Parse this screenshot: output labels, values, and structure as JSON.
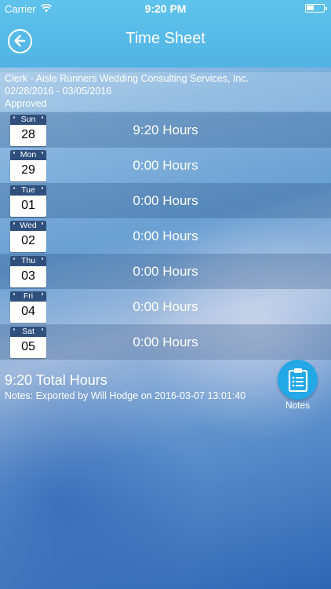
{
  "status_bar": {
    "carrier": "Carrier",
    "time": "9:20 PM"
  },
  "header": {
    "title": "Time Sheet"
  },
  "info": {
    "job": "Clerk - Aisle Runners Wedding Consulting Services, Inc.",
    "date_range": "02/28/2016 - 03/05/2016",
    "status": "Approved"
  },
  "days": [
    {
      "weekday": "Sun",
      "date": "28",
      "hours": "9:20 Hours"
    },
    {
      "weekday": "Mon",
      "date": "29",
      "hours": "0:00 Hours"
    },
    {
      "weekday": "Tue",
      "date": "01",
      "hours": "0:00 Hours"
    },
    {
      "weekday": "Wed",
      "date": "02",
      "hours": "0:00 Hours"
    },
    {
      "weekday": "Thu",
      "date": "03",
      "hours": "0:00 Hours"
    },
    {
      "weekday": "Fri",
      "date": "04",
      "hours": "0:00 Hours"
    },
    {
      "weekday": "Sat",
      "date": "05",
      "hours": "0:00 Hours"
    }
  ],
  "summary": {
    "total": "9:20 Total Hours",
    "notes": "Notes: Exported by Will Hodge on 2016-03-07 13:01:40"
  },
  "notes_button": {
    "label": "Notes",
    "icon": "clipboard-icon"
  },
  "colors": {
    "header": "#52b3e3",
    "notes_button": "#23a7e6",
    "calendar_header": "#2f4f7d"
  }
}
